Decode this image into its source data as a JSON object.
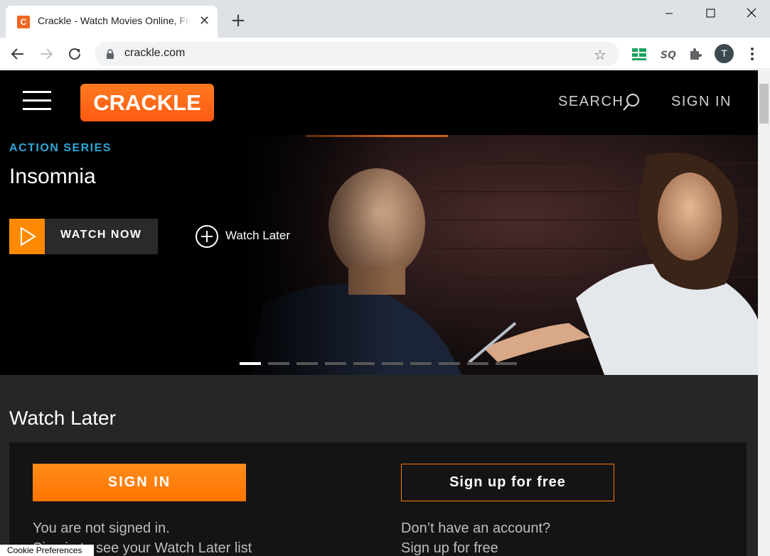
{
  "browser": {
    "tab_title": "Crackle - Watch Movies Online, Free",
    "favicon_letter": "C",
    "url": "crackle.com",
    "profile_initial": "T"
  },
  "site": {
    "logo": "CRACKLE",
    "search_label": "SEARCH",
    "signin_label": "SIGN IN"
  },
  "hero": {
    "genre": "ACTION SERIES",
    "title": "Insomnia",
    "watch_now": "WATCH NOW",
    "watch_later": "Watch Later",
    "slide_count": 10,
    "active_slide": 0
  },
  "watch_later": {
    "heading": "Watch Later",
    "signin_button": "SIGN IN",
    "signup_button": "Sign up for free",
    "not_signed_in": "You are not signed in.",
    "no_account": "Don’t have an account?",
    "signin_hint": "Sign in to see your Watch Later list",
    "signup_hint": "Sign up for free"
  },
  "footer": {
    "cookie_preferences": "Cookie Preferences"
  },
  "colors": {
    "brand_orange": "#ff7a00",
    "genre_blue": "#2fa8d8",
    "page_bg": "#262626"
  }
}
